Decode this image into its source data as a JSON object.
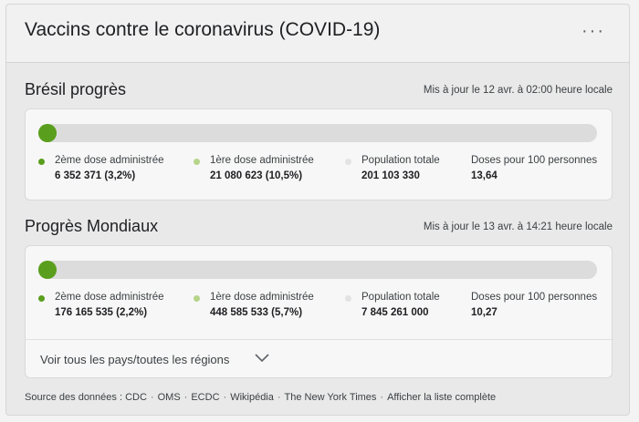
{
  "header": {
    "title": "Vaccins contre le coronavirus (COVID-19)",
    "more_glyph": "···"
  },
  "colors": {
    "dose2": "#5a9e1e",
    "dose1": "#b6d48a",
    "population": "#e3e3e3",
    "track": "#dcdcdc"
  },
  "sections": [
    {
      "title": "Brésil progrès",
      "updated": "Mis à jour le 12 avr. à 02:00 heure locale",
      "progress": {
        "dose2_percent": 3.2,
        "dose1_percent": 10.5
      },
      "stats": [
        {
          "label": "2ème dose administrée",
          "value": "6 352 371 (3,2%)"
        },
        {
          "label": "1ère dose administrée",
          "value": "21 080 623 (10,5%)"
        },
        {
          "label": "Population totale",
          "value": "201 103 330"
        },
        {
          "label": "Doses pour 100 personnes",
          "value": "13,64"
        }
      ]
    },
    {
      "title": "Progrès Mondiaux",
      "updated": "Mis à jour le 13 avr. à 14:21 heure locale",
      "progress": {
        "dose2_percent": 2.2,
        "dose1_percent": 5.7
      },
      "stats": [
        {
          "label": "2ème dose administrée",
          "value": "176 165 535 (2,2%)"
        },
        {
          "label": "1ère dose administrée",
          "value": "448 585 533 (5,7%)"
        },
        {
          "label": "Population totale",
          "value": "7 845 261 000"
        },
        {
          "label": "Doses pour 100 personnes",
          "value": "10,27"
        }
      ],
      "expand_label": "Voir tous les pays/toutes les régions"
    }
  ],
  "sources": {
    "prefix": "Source des données :",
    "items": [
      "CDC",
      "OMS",
      "ECDC",
      "Wikipédia",
      "The New York Times",
      "Afficher la liste complète"
    ],
    "separator": "·"
  }
}
